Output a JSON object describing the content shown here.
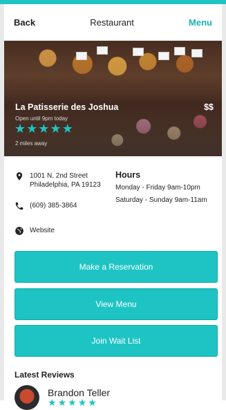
{
  "header": {
    "back_label": "Back",
    "title": "Restaurant",
    "menu_label": "Menu"
  },
  "restaurant": {
    "name": "La Patisserie des Joshua",
    "price": "$$",
    "open_status": "Open until 9pm today",
    "rating": 5,
    "distance": "2 miles away"
  },
  "contact": {
    "address_line1": "1001 N. 2nd Street",
    "address_line2": "Philadelphia, PA 19123",
    "phone": "(609) 385-3864",
    "website_label": "Website"
  },
  "hours": {
    "title": "Hours",
    "weekday": "Monday - Friday  9am-10pm",
    "weekend": "Saturday - Sunday  9am-11am"
  },
  "actions": {
    "reservation_label": "Make a Reservation",
    "menu_label": "View Menu",
    "waitlist_label": "Join Wait List"
  },
  "reviews": {
    "title": "Latest Reviews",
    "first_reviewer": "Brandon Teller",
    "first_rating": 5
  },
  "colors": {
    "accent": "#1ec4c4",
    "accent_text": "#19b4b4"
  },
  "icons": [
    "location-pin-icon",
    "phone-icon",
    "globe-icon",
    "star-icon"
  ]
}
